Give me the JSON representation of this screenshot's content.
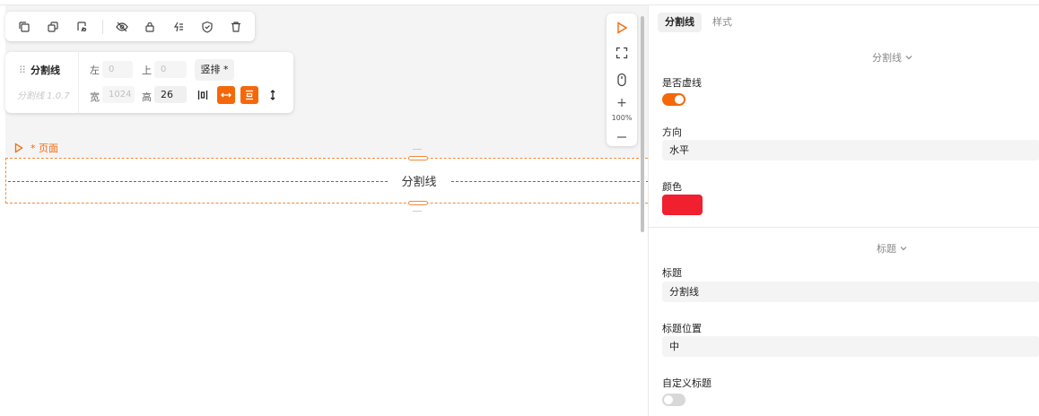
{
  "colors": {
    "accent": "#f5680a",
    "divider_color": "#f0202e",
    "toggle_off": "#d8d8d8"
  },
  "toolbar": {
    "icons": [
      "copy-icon",
      "duplicate-icon",
      "paste-style-icon",
      "hide-icon",
      "lock-icon",
      "event-icon",
      "shield-icon",
      "delete-icon"
    ]
  },
  "info_panel": {
    "component_name": "分割线",
    "version": "分割线 1.0.7",
    "left_label": "左",
    "left_value": "0",
    "top_label": "上",
    "top_value": "0",
    "width_label": "宽",
    "width_value": "1024",
    "height_label": "高",
    "height_value": "26",
    "layout_button": "竖排 *"
  },
  "mini_toolbar": {
    "zoom": "100%"
  },
  "canvas": {
    "page_label": "* 页面",
    "divider_title": "分割线"
  },
  "panel": {
    "tabs": [
      {
        "label": "分割线",
        "active": true
      },
      {
        "label": "样式",
        "active": false
      }
    ],
    "section1_title": "分割线",
    "dashed_label": "是否虚线",
    "dashed_on": true,
    "direction_label": "方向",
    "direction_value": "水平",
    "color_label": "颜色",
    "section2_title": "标题",
    "title_label": "标题",
    "title_value": "分割线",
    "title_position_label": "标题位置",
    "title_position_value": "中",
    "custom_title_label": "自定义标题",
    "custom_title_on": false
  }
}
